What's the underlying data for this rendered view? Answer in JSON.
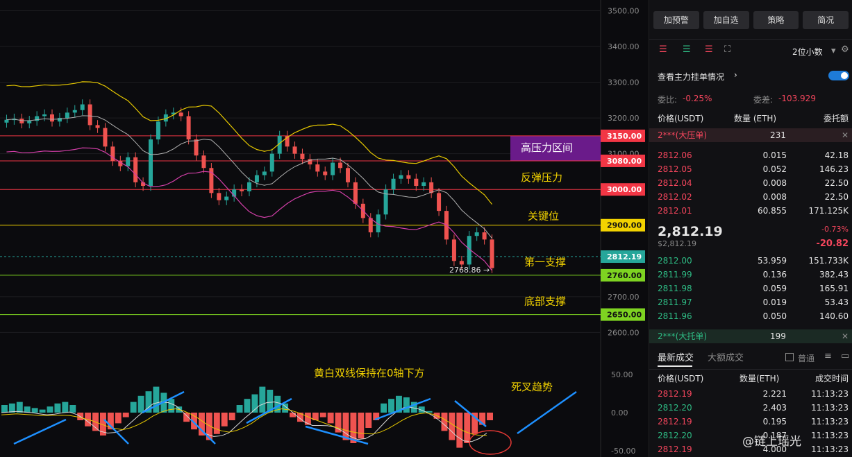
{
  "chart_data": {
    "type": "line",
    "price_axis": {
      "ticks": [
        "3500.00",
        "3400.00",
        "3300.00",
        "3200.00",
        "3100.00",
        "2700.00",
        "2600.00"
      ],
      "tick_values": [
        3500,
        3400,
        3300,
        3200,
        3100,
        2700,
        2600
      ],
      "range": [
        2560,
        3530
      ]
    },
    "level_lines": [
      {
        "label": "3150.00",
        "value": 3150,
        "color": "#f23645"
      },
      {
        "label": "3080.00",
        "value": 3080,
        "color": "#f23645"
      },
      {
        "label": "3000.00",
        "value": 3000,
        "color": "#f23645"
      },
      {
        "label": "2900.00",
        "value": 2900,
        "color": "#f2d200"
      },
      {
        "label": "2812.19",
        "value": 2812.19,
        "color": "#26a69a"
      },
      {
        "label": "2760.00",
        "value": 2760,
        "color": "#7ed321"
      },
      {
        "label": "2650.00",
        "value": 2650,
        "color": "#7ed321"
      }
    ],
    "annotations": {
      "high_pressure_zone": "高压力区间",
      "rebound_pressure": "反弹压力",
      "key_level": "关键位",
      "first_support": "第一支撑",
      "bottom_support": "底部支撑",
      "macd_note": "黄白双线保持在0轴下方",
      "death_cross": "死叉趋势",
      "low_marker": "2768.86"
    },
    "price_series": [
      3195,
      3198,
      3185,
      3192,
      3205,
      3210,
      3190,
      3200,
      3215,
      3222,
      3238,
      3180,
      3172,
      3120,
      3080,
      3065,
      3090,
      3020,
      3010,
      3140,
      3190,
      3210,
      3215,
      3205,
      3140,
      3095,
      3060,
      2990,
      2970,
      2980,
      3000,
      2995,
      3020,
      3040,
      3050,
      3100,
      3150,
      3120,
      3100,
      3085,
      3070,
      3050,
      3040,
      3075,
      3060,
      3020,
      2960,
      2920,
      2880,
      2930,
      3000,
      3030,
      3040,
      3030,
      3010,
      3020,
      2990,
      2940,
      2860,
      2800,
      2790,
      2870,
      2880,
      2860,
      2780
    ],
    "indicator_axis": {
      "ticks": [
        "50.00",
        "0.00",
        "-50.00"
      ],
      "tick_values": [
        50,
        0,
        -50
      ]
    },
    "macd_hist": [
      10,
      12,
      14,
      8,
      6,
      4,
      8,
      12,
      14,
      10,
      -10,
      -18,
      -24,
      -30,
      -22,
      -14,
      -6,
      14,
      22,
      28,
      34,
      26,
      18,
      8,
      -12,
      -22,
      -30,
      -36,
      -28,
      -18,
      -10,
      10,
      18,
      24,
      34,
      30,
      22,
      12,
      -6,
      -12,
      -16,
      -10,
      -6,
      -14,
      -26,
      -36,
      -40,
      -34,
      -20,
      -10,
      12,
      18,
      22,
      20,
      14,
      8,
      2,
      -8,
      -24,
      -36,
      -46,
      -40,
      -28,
      -16,
      -10
    ]
  },
  "panel": {
    "buttons": [
      "加预警",
      "加自选",
      "策略",
      "简况"
    ],
    "decimals": "2位小数",
    "main_orders_label": "查看主力挂单情况",
    "ratio_label": "委比:",
    "ratio_value": "-0.25%",
    "diff_label": "委差:",
    "diff_value": "-103.929",
    "headers": {
      "price": "价格(USDT)",
      "qty": "数量 (ETH)",
      "total": "委托额"
    },
    "big_ask": {
      "label": "2***(大压单)",
      "value": "231"
    },
    "asks": [
      {
        "price": "2812.06",
        "qty": "0.015",
        "total": "42.18"
      },
      {
        "price": "2812.05",
        "qty": "0.052",
        "total": "146.23"
      },
      {
        "price": "2812.04",
        "qty": "0.008",
        "total": "22.50"
      },
      {
        "price": "2812.02",
        "qty": "0.008",
        "total": "22.50"
      },
      {
        "price": "2812.01",
        "qty": "60.855",
        "total": "171.125K"
      }
    ],
    "last_price": "2,812.19",
    "last_price_usd": "$2,812.19",
    "change_pct": "-0.73%",
    "change_abs": "-20.82",
    "bids": [
      {
        "price": "2812.00",
        "qty": "53.959",
        "total": "151.733K"
      },
      {
        "price": "2811.99",
        "qty": "0.136",
        "total": "382.43"
      },
      {
        "price": "2811.98",
        "qty": "0.059",
        "total": "165.91"
      },
      {
        "price": "2811.97",
        "qty": "0.019",
        "total": "53.43"
      },
      {
        "price": "2811.96",
        "qty": "0.050",
        "total": "140.60"
      }
    ],
    "big_bid": {
      "label": "2***(大托单)",
      "value": "199"
    },
    "trade_tabs": {
      "latest": "最新成交",
      "large": "大额成交",
      "normal": "普通"
    },
    "trade_headers": {
      "price": "价格(USDT)",
      "qty": "数量(ETH)",
      "time": "成交时间"
    },
    "trades": [
      {
        "price": "2812.19",
        "qty": "2.221",
        "time": "11:13:23",
        "side": "sell"
      },
      {
        "price": "2812.20",
        "qty": "2.403",
        "time": "11:13:23",
        "side": "buy"
      },
      {
        "price": "2812.19",
        "qty": "0.195",
        "time": "11:13:23",
        "side": "sell"
      },
      {
        "price": "2812.20",
        "qty": "0.187",
        "time": "11:13:23",
        "side": "buy"
      },
      {
        "price": "2812.19",
        "qty": "4.000",
        "time": "11:13:23",
        "side": "sell"
      }
    ],
    "watermark": "@链上瑶光"
  }
}
